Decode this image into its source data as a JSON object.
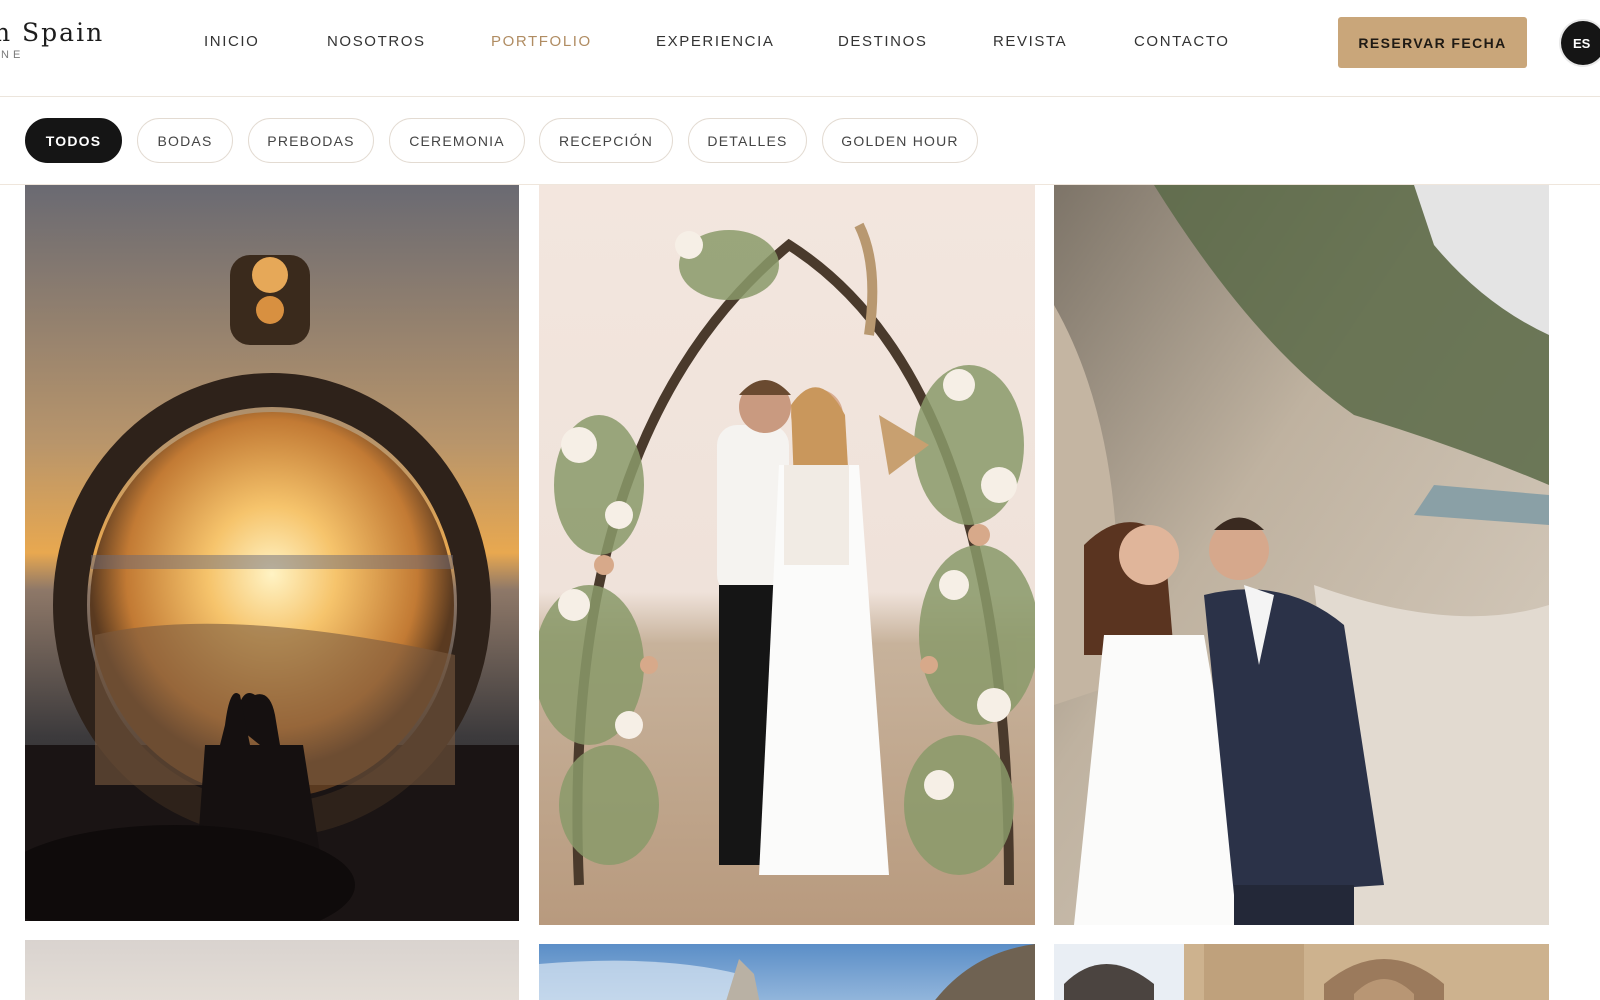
{
  "brand": {
    "name": "n Spain",
    "tagline": "INE"
  },
  "nav": {
    "items": [
      {
        "label": "INICIO",
        "active": false
      },
      {
        "label": "NOSOTROS",
        "active": false
      },
      {
        "label": "PORTFOLIO",
        "active": true
      },
      {
        "label": "EXPERIENCIA",
        "active": false
      },
      {
        "label": "DESTINOS",
        "active": false
      },
      {
        "label": "REVISTA",
        "active": false
      },
      {
        "label": "CONTACTO",
        "active": false
      }
    ],
    "cta_label": "RESERVAR FECHA",
    "language": "ES"
  },
  "filters": {
    "items": [
      {
        "label": "TODOS",
        "active": true
      },
      {
        "label": "BODAS",
        "active": false
      },
      {
        "label": "PREBODAS",
        "active": false
      },
      {
        "label": "CEREMONIA",
        "active": false
      },
      {
        "label": "RECEPCIÓN",
        "active": false
      },
      {
        "label": "DETALLES",
        "active": false
      },
      {
        "label": "GOLDEN HOUR",
        "active": false
      }
    ]
  },
  "colors": {
    "accent": "#b08c62",
    "cta_background": "#c9a67a",
    "active_chip": "#151515"
  },
  "gallery": {
    "photos": [
      {
        "subject": "couple kissing at sunset seen through engagement ring"
      },
      {
        "subject": "couple embracing under floral arch on the beach"
      },
      {
        "subject": "couple kissing on rocky seashore"
      },
      {
        "subject": "soft pastel sky photo"
      },
      {
        "subject": "blue sky with rocky cliff"
      },
      {
        "subject": "historic architecture with dome and arches"
      }
    ]
  }
}
